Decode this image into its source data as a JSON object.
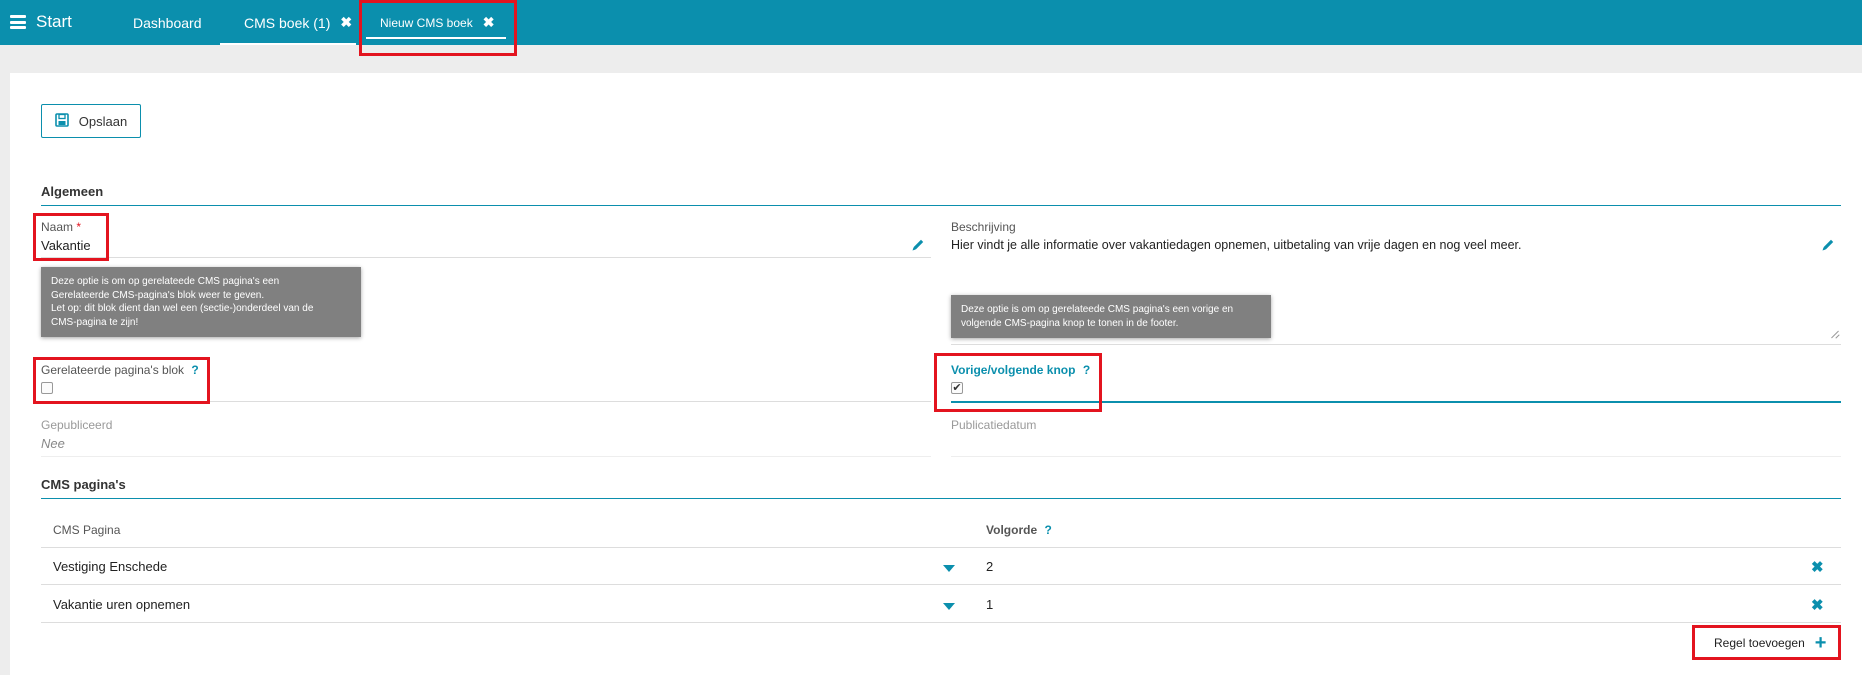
{
  "topbar": {
    "start_label": "Start",
    "tabs": [
      {
        "label": "Dashboard"
      },
      {
        "label": "CMS boek (1)",
        "close": "✖"
      },
      {
        "label": "Nieuw CMS boek",
        "close": "✖"
      }
    ]
  },
  "toolbar": {
    "save_label": "Opslaan",
    "save_icon": "floppy-disk-icon"
  },
  "general": {
    "title": "Algemeen",
    "naam": {
      "label": "Naam",
      "required_mark": "*",
      "value": "Vakantie"
    },
    "beschrijving": {
      "label": "Beschrijving",
      "value": "Hier vindt je alle informatie over vakantiedagen opnemen, uitbetaling van vrije dagen en nog veel meer."
    },
    "tooltip_related": {
      "line1": "Deze optie is om op gerelateede CMS pagina's een",
      "line2": "Gerelateerde CMS-pagina's blok weer te geven.",
      "line3": "Let op: dit blok dient dan wel een (sectie-)onderdeel van de",
      "line4": "CMS-pagina te zijn!"
    },
    "tooltip_prevnext": {
      "line1": "Deze optie is om op gerelateede CMS pagina's een vorige en",
      "line2": "volgende CMS-pagina knop te tonen in de footer."
    },
    "related_block": {
      "label": "Gerelateerde pagina's blok",
      "help": "?",
      "checked": false
    },
    "prev_next": {
      "label": "Vorige/volgende knop",
      "help": "?",
      "checked": true,
      "check_mark": "✔"
    },
    "gepubliceerd": {
      "label": "Gepubliceerd",
      "value": "Nee"
    },
    "publicatiedatum": {
      "label": "Publicatiedatum",
      "value": ""
    }
  },
  "cms_pages": {
    "title": "CMS pagina's",
    "col_page": "CMS Pagina",
    "col_order": "Volgorde",
    "col_order_help": "?",
    "rows": [
      {
        "page": "Vestiging Enschede",
        "order": "2"
      },
      {
        "page": "Vakantie uren opnemen",
        "order": "1"
      }
    ],
    "add_label": "Regel toevoegen",
    "add_icon": "+"
  },
  "colors": {
    "accent": "#0b8fad",
    "highlight": "#e3141f"
  }
}
